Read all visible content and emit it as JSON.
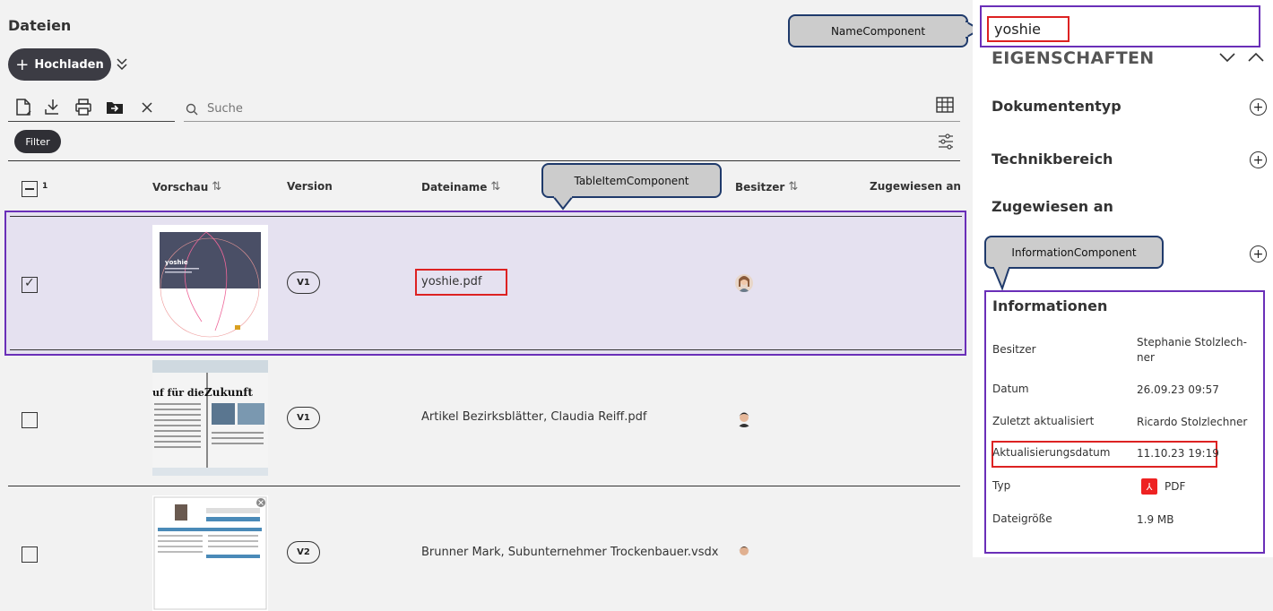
{
  "header": {
    "title": "Dateien",
    "upload_label": "Hochladen"
  },
  "toolbar": {
    "icons": [
      "new-document-icon",
      "download-icon",
      "print-icon",
      "move-to-folder-icon",
      "close-icon"
    ],
    "search_placeholder": "Suche",
    "view_icon": "table-view-icon",
    "filter_label": "Filter",
    "settings_icon": "sliders-icon"
  },
  "table": {
    "selected_count": "1",
    "columns": [
      "Vorschau",
      "Version",
      "Dateiname",
      "Besitzer",
      "Zugewiesen an"
    ],
    "rows": [
      {
        "version": "V1",
        "filename": "yoshie.pdf",
        "selected": true
      },
      {
        "version": "V1",
        "filename": "Artikel Bezirksblätter, Claudia Reiff.pdf",
        "selected": false
      },
      {
        "version": "V2",
        "filename": "Brunner Mark, Subunternehmer Trockenbauer.vsdx",
        "selected": false
      }
    ]
  },
  "thumbnails": {
    "row1": {
      "text": "yoshie"
    },
    "row2": {
      "left": "uf für die",
      "right": "Zukunft"
    }
  },
  "callouts": {
    "name": "NameComponent",
    "table_item": "TableItemComponent",
    "information": "InformationComponent"
  },
  "sidebar": {
    "name_value": "yoshie",
    "properties_title": "EIGENSCHAFTEN",
    "sections": [
      "Dokumententyp",
      "Technikbereich",
      "Zugewiesen an"
    ],
    "info": {
      "title": "Informationen",
      "rows": [
        {
          "label": "Besitzer",
          "value": "Stephanie Stolzlech-ner"
        },
        {
          "label": "Datum",
          "value": "26.09.23 09:57"
        },
        {
          "label": "Zuletzt aktualisiert",
          "value": "Ricardo Stolzlechner"
        },
        {
          "label": "Aktualisierungsdatum",
          "value": "11.10.23 19:19"
        },
        {
          "label": "Typ",
          "value": "PDF"
        },
        {
          "label": "Dateigröße",
          "value": "1.9 MB"
        }
      ]
    }
  },
  "colors": {
    "accent_outline": "#6a2fb8",
    "highlight_red": "#dd2222",
    "selected_row": "#e5e1f0",
    "dark_button": "#3c3c44"
  }
}
